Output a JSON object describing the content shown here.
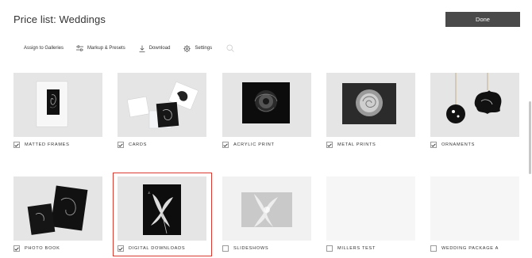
{
  "header": {
    "title": "Price list: Weddings",
    "done_label": "Done"
  },
  "toolbar": {
    "assign_label": "Assign to Galleries",
    "markup_label": "Markup & Presets",
    "download_label": "Download",
    "settings_label": "Settings"
  },
  "products": [
    {
      "label": "MATTED FRAMES",
      "checked": true
    },
    {
      "label": "CARDS",
      "checked": true
    },
    {
      "label": "ACRYLIC PRINT",
      "checked": true
    },
    {
      "label": "METAL PRINTS",
      "checked": true
    },
    {
      "label": "ORNAMENTS",
      "checked": true
    },
    {
      "label": "PHOTO BOOK",
      "checked": true
    },
    {
      "label": "DIGITAL DOWNLOADS",
      "checked": true,
      "selected": true
    },
    {
      "label": "SLIDESHOWS",
      "checked": false
    },
    {
      "label": "MILLERS TEST",
      "checked": false
    },
    {
      "label": "WEDDING PACKAGE A",
      "checked": false
    }
  ],
  "colors": {
    "selection": "#d9392e",
    "button": "#4a4a4a",
    "thumb_bg": "#e5e5e5"
  }
}
